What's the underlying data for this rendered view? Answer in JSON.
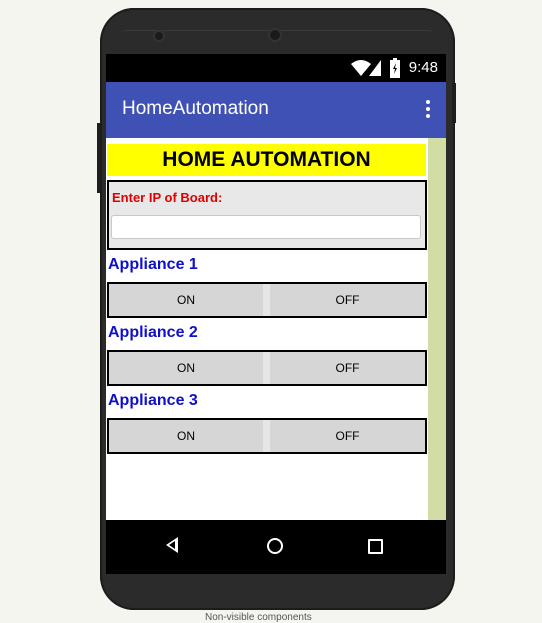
{
  "status_bar": {
    "time": "9:48"
  },
  "app_bar": {
    "title": "HomeAutomation",
    "menu_icon": "more-vert-icon"
  },
  "banner": {
    "text": "HOME AUTOMATION",
    "background": "#ffff00"
  },
  "ip_section": {
    "label": "Enter IP of Board:",
    "value": "",
    "placeholder": ""
  },
  "appliances": [
    {
      "label": "Appliance 1",
      "on_label": "ON",
      "off_label": "OFF"
    },
    {
      "label": "Appliance 2",
      "on_label": "ON",
      "off_label": "OFF"
    },
    {
      "label": "Appliance 3",
      "on_label": "ON",
      "off_label": "OFF"
    }
  ],
  "nav_bar": {
    "back_icon": "back-icon",
    "home_icon": "home-icon",
    "recents_icon": "recents-icon"
  },
  "colors": {
    "app_bar": "#3f51b5",
    "appliance_label": "#1010c8",
    "ip_label": "#e00000",
    "scroll_strip": "#d2dca5"
  },
  "caption": "Non-visible components"
}
